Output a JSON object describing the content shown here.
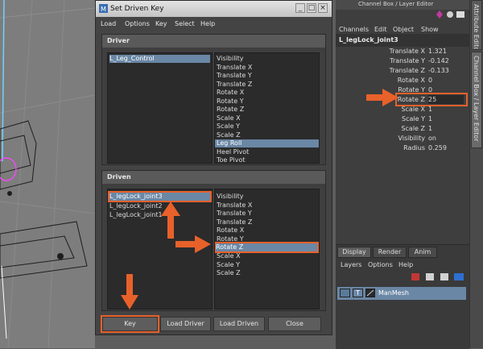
{
  "dialog": {
    "title": "Set Driven Key",
    "menu": [
      "Load",
      "Options",
      "Key",
      "Select",
      "Help"
    ],
    "driver": {
      "header": "Driver",
      "objects": [
        "L_Leg_Control"
      ],
      "attributes": [
        "Visibility",
        "Translate X",
        "Translate Y",
        "Translate Z",
        "Rotate X",
        "Rotate Y",
        "Rotate Z",
        "Scale X",
        "Scale Y",
        "Scale Z",
        "Leg Roll",
        "Heel Pivot",
        "Toe Pivot"
      ],
      "selected_attribute": "Leg Roll"
    },
    "driven": {
      "header": "Driven",
      "objects": [
        "L_legLock_joint3",
        "L_legLock_joint2",
        "L_legLock_joint1"
      ],
      "attributes": [
        "Visibility",
        "Translate X",
        "Translate Y",
        "Translate Z",
        "Rotate X",
        "Rotate Y",
        "Rotate Z",
        "Scale X",
        "Scale Y",
        "Scale Z"
      ],
      "selected_attribute": "Rotate Z"
    },
    "buttons": [
      "Key",
      "Load Driver",
      "Load Driven",
      "Close"
    ]
  },
  "channel_box": {
    "title": "Channel Box / Layer Editor",
    "menu": [
      "Channels",
      "Edit",
      "Object",
      "Show"
    ],
    "object_name": "L_legLock_joint3",
    "attributes": [
      {
        "label": "Translate X",
        "value": "1.321"
      },
      {
        "label": "Translate Y",
        "value": "-0.142"
      },
      {
        "label": "Translate Z",
        "value": "-0.133"
      },
      {
        "label": "Rotate X",
        "value": "0"
      },
      {
        "label": "Rotate Y",
        "value": "0"
      },
      {
        "label": "Rotate Z",
        "value": "25"
      },
      {
        "label": "Scale X",
        "value": "1"
      },
      {
        "label": "Scale Y",
        "value": "1"
      },
      {
        "label": "Scale Z",
        "value": "1"
      },
      {
        "label": "Visibility",
        "value": "on"
      },
      {
        "label": "Radius",
        "value": "0.259"
      }
    ]
  },
  "layer_editor": {
    "tabs": [
      "Display",
      "Render",
      "Anim"
    ],
    "menu": [
      "Layers",
      "Options",
      "Help"
    ],
    "layer": {
      "visibility": "V",
      "type": "T",
      "name": "ManMesh"
    }
  },
  "side_tabs": [
    "Attribute Editor",
    "Channel Box / Layer Editor"
  ],
  "colors": {
    "highlight": "#e8612b",
    "selection": "#6a87a5"
  }
}
